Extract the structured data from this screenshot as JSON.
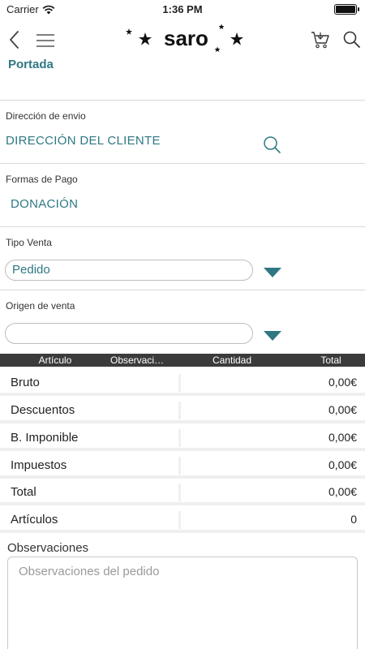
{
  "status_bar": {
    "carrier": "Carrier",
    "time": "1:36 PM"
  },
  "nav": {
    "logo_text": "saro"
  },
  "breadcrumb": "Portada",
  "shipping": {
    "label": "Dirección de envio",
    "value": "DIRECCIÓN DEL CLIENTE"
  },
  "payment": {
    "label": "Formas de Pago",
    "value": "DONACIÓN"
  },
  "sale_type": {
    "label": "Tipo Venta",
    "selected": "Pedido"
  },
  "sale_origin": {
    "label": "Origen de venta",
    "selected": ""
  },
  "table": {
    "headers": [
      "Artículo",
      "Observaci…",
      "Cantidad",
      "Total"
    ]
  },
  "totals": [
    {
      "label": "Bruto",
      "value": "0,00€"
    },
    {
      "label": "Descuentos",
      "value": "0,00€"
    },
    {
      "label": "B. Imponible",
      "value": "0,00€"
    },
    {
      "label": "Impuestos",
      "value": "0,00€"
    },
    {
      "label": "Total",
      "value": "0,00€"
    },
    {
      "label": "Artículos",
      "value": "0"
    }
  ],
  "observations": {
    "label": "Observaciones",
    "placeholder": "Observaciones del pedido"
  },
  "colors": {
    "accent": "#2f7883",
    "header_bg": "#3b3b3b"
  }
}
